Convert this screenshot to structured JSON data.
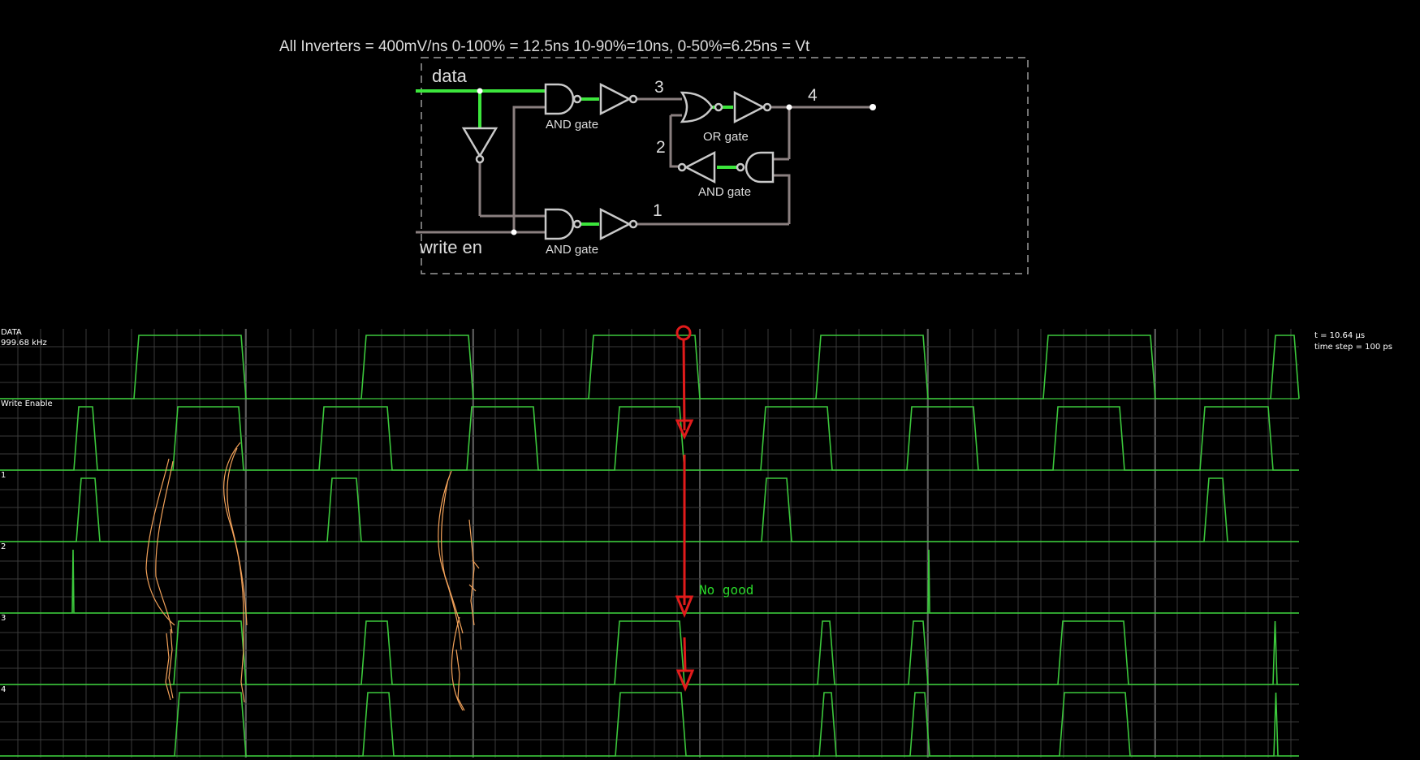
{
  "header": {
    "note": "All Inverters = 400mV/ns 0-100% = 12.5ns   10-90%=10ns, 0-50%=6.25ns = Vt"
  },
  "schematic": {
    "input_data_label": "data",
    "input_write_label": "write en",
    "gate_labels": [
      "AND gate",
      "AND gate",
      "OR gate",
      "AND gate"
    ],
    "node_labels": [
      "1",
      "2",
      "3",
      "4"
    ]
  },
  "scope": {
    "info_time": "t = 10.64 µs",
    "info_step": "time step = 100 ps",
    "annotation": "No  good",
    "channels": [
      {
        "name": "DATA",
        "freq": "999.68 kHz"
      },
      {
        "name": "Write Enable"
      },
      {
        "name": "1"
      },
      {
        "name": "2"
      },
      {
        "name": "3"
      },
      {
        "name": "4"
      }
    ]
  },
  "colors": {
    "trace": "#3cc83c",
    "grid": "#3a3a3a",
    "wire_off": "#8a7f7f",
    "wire_on": "#3ce63c",
    "annotation_red": "#e11b1b",
    "annotation_green": "#2ad82a",
    "sketch": "#f3a25a"
  }
}
